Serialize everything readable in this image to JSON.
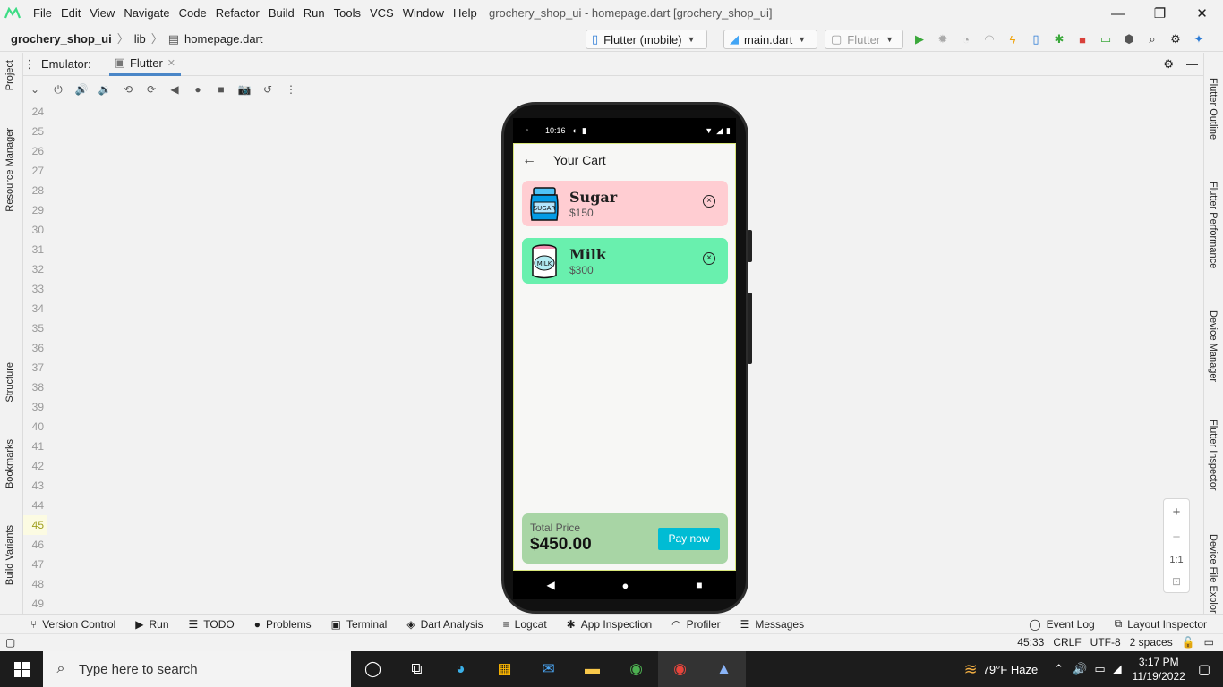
{
  "window": {
    "menu": [
      "File",
      "Edit",
      "View",
      "Navigate",
      "Code",
      "Refactor",
      "Build",
      "Run",
      "Tools",
      "VCS",
      "Window",
      "Help"
    ],
    "title": "grochery_shop_ui - homepage.dart [grochery_shop_ui]",
    "controls": {
      "minimize": "—",
      "restore": "❐",
      "close": "✕"
    }
  },
  "breadcrumb": {
    "project": "grochery_shop_ui",
    "folder": "lib",
    "file": "homepage.dart"
  },
  "toolbar": {
    "device": "Flutter (mobile)",
    "config": "main.dart",
    "attach": "Flutter"
  },
  "emulator": {
    "label": "Emulator:",
    "tab": "Flutter"
  },
  "left_tabs": [
    "Project",
    "Resource Manager",
    "Structure",
    "Bookmarks",
    "Build Variants"
  ],
  "right_tabs": [
    "Flutter Outline",
    "Flutter Performance",
    "Device Manager",
    "Flutter Inspector",
    "Device File Explor"
  ],
  "gutter": {
    "lines": [
      "24",
      "25",
      "26",
      "27",
      "28",
      "29",
      "30",
      "31",
      "32",
      "33",
      "34",
      "35",
      "36",
      "37",
      "38",
      "39",
      "40",
      "41",
      "42",
      "43",
      "44",
      "45",
      "46",
      "47",
      "48",
      "49"
    ],
    "current": "45"
  },
  "zoom": {
    "plus": "+",
    "minus": "−",
    "ratio": "1:1"
  },
  "phone": {
    "status_time": "10:16",
    "appbar_title": "Your Cart",
    "items": [
      {
        "name": "Sugar",
        "price": "$150",
        "color": "#ffcdd2",
        "icon_text": "SUGAR"
      },
      {
        "name": "Milk",
        "price": "$300",
        "color": "#69f0ae",
        "icon_text": "MILK"
      }
    ],
    "total_label": "Total Price",
    "total_amount": "$450.00",
    "pay_label": "Pay now"
  },
  "bottom_tabs": [
    "Version Control",
    "Run",
    "TODO",
    "Problems",
    "Terminal",
    "Dart Analysis",
    "Logcat",
    "App Inspection",
    "Profiler",
    "Messages"
  ],
  "bottom_right_tabs": [
    "Event Log",
    "Layout Inspector"
  ],
  "status": {
    "position": "45:33",
    "line_sep": "CRLF",
    "encoding": "UTF-8",
    "indent": "2 spaces"
  },
  "taskbar": {
    "search_placeholder": "Type here to search",
    "weather": "79°F  Haze",
    "time": "3:17 PM",
    "date": "11/19/2022"
  }
}
